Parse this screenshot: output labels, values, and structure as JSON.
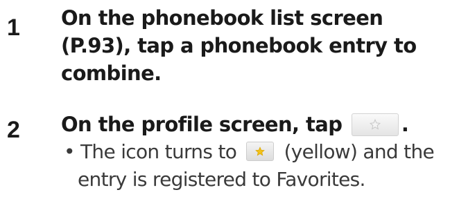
{
  "steps": [
    {
      "number": "1",
      "lines": [
        "On the phonebook list screen",
        "(P.93), tap a phonebook entry to",
        "combine."
      ]
    },
    {
      "number": "2",
      "text_before_icon": "On the profile screen, tap",
      "text_after_icon": ".",
      "icon": "star-outline-icon",
      "bullet": {
        "marker": "•",
        "text_before_icon": "The icon turns to",
        "icon": "star-yellow-icon",
        "text_after_icon": "(yellow) and the",
        "line2": "entry is registered to Favorites."
      }
    }
  ],
  "colors": {
    "text": "#1a1a1a",
    "bullet_text": "#3a3a3a",
    "star_yellow": "#f2c21a",
    "star_outline": "#c8c8c8"
  }
}
